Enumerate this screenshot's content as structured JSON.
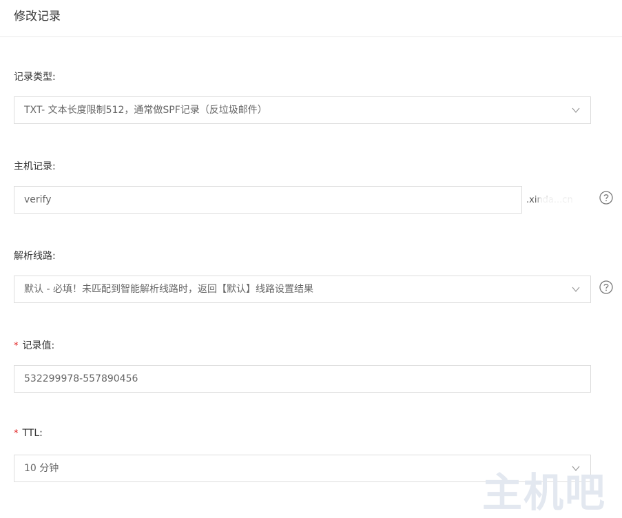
{
  "header": {
    "title": "修改记录"
  },
  "record_type": {
    "label": "记录类型:",
    "value": "TXT- 文本长度限制512，通常做SPF记录（反垃圾邮件）",
    "chevron_icon": "chevron-down-icon"
  },
  "host_record": {
    "label": "主机记录:",
    "value": "verify",
    "domain_suffix": ".xinda...cn",
    "help_icon": "question-circle-icon"
  },
  "line": {
    "label": "解析线路:",
    "value": "默认 - 必填！未匹配到智能解析线路时，返回【默认】线路设置结果",
    "chevron_icon": "chevron-down-icon",
    "help_icon": "question-circle-icon"
  },
  "record_value": {
    "required_mark": "*",
    "label": "记录值:",
    "value": "532299978-557890456"
  },
  "ttl": {
    "required_mark": "*",
    "label": "TTL:",
    "value": "10 分钟",
    "chevron_icon": "chevron-down-icon"
  },
  "watermark": {
    "text": "主机吧"
  }
}
